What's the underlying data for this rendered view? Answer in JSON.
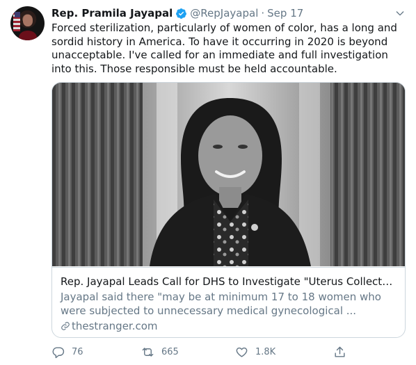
{
  "tweet": {
    "author": {
      "display_name": "Rep. Pramila Jayapal",
      "handle": "@RepJayapal",
      "verified": true,
      "avatar_icon": "profile-photo"
    },
    "separator": "·",
    "date": "Sep 17",
    "text": "Forced sterilization, particularly of women of color, has a long and sordid history in America. To have it occurring in 2020 is beyond unacceptable. I've called for an immediate and full investigation into this. Those responsible must be held accountable.",
    "card": {
      "title": "Rep. Jayapal Leads Call for DHS to Investigate \"Uterus Collecto...",
      "description": "Jayapal said there \"may be at minimum 17 to 18 women who were subjected to unnecessary medical gynecological ...",
      "domain": "thestranger.com",
      "image_description_icon": "article-photo"
    },
    "actions": {
      "reply_count": "76",
      "retweet_count": "665",
      "like_count": "1.8K"
    }
  },
  "colors": {
    "text_primary": "#14171a",
    "text_secondary": "#657786",
    "verified_blue": "#1da1f2",
    "border": "#ccd6dd"
  }
}
